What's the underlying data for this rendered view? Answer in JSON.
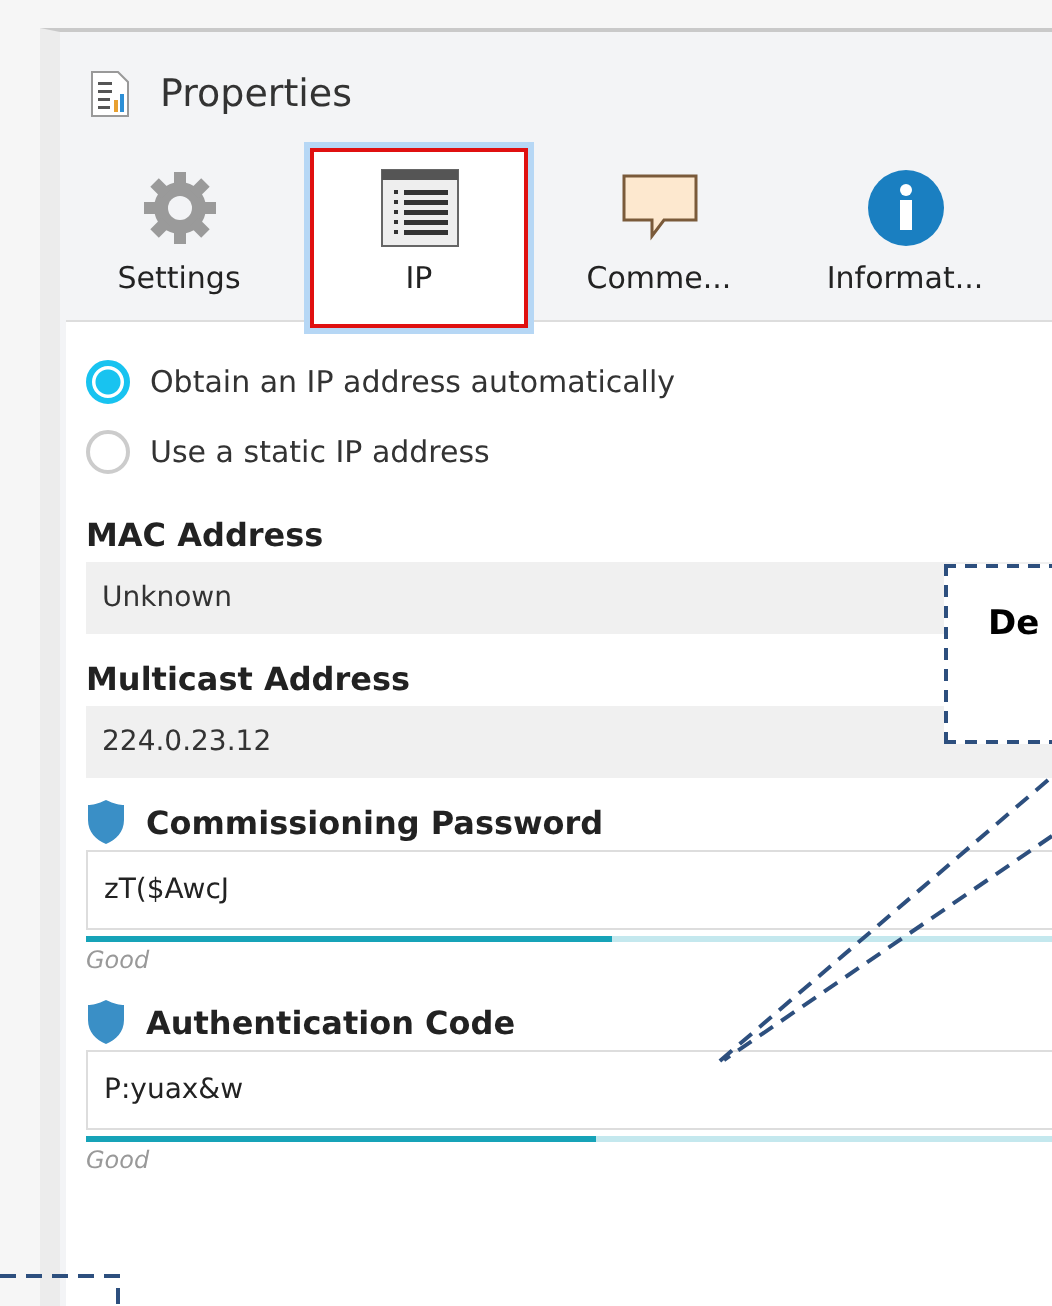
{
  "window": {
    "title": "Properties"
  },
  "tabs": [
    {
      "label": "Settings",
      "kind": "gear",
      "selected": false
    },
    {
      "label": "IP",
      "kind": "list",
      "selected": true
    },
    {
      "label": "Comme...",
      "kind": "comment",
      "selected": false
    },
    {
      "label": "Informat...",
      "kind": "info",
      "selected": false
    }
  ],
  "ip_mode": [
    {
      "label": "Obtain an IP address automatically",
      "selected": true
    },
    {
      "label": "Use a static IP address",
      "selected": false
    }
  ],
  "fields": [
    {
      "kind": "readonly",
      "label": "MAC Address",
      "value": "Unknown"
    },
    {
      "kind": "readonly",
      "label": "Multicast Address",
      "value": "224.0.23.12"
    },
    {
      "kind": "secure",
      "label": "Commissioning Password",
      "value": "zT($AwcJ",
      "level": 0.525,
      "strength": "Good"
    },
    {
      "kind": "secure",
      "label": "Authentication Code",
      "value": "P:yuax&w",
      "level": 0.51,
      "strength": "Good"
    }
  ],
  "callout": {
    "text": "De"
  }
}
